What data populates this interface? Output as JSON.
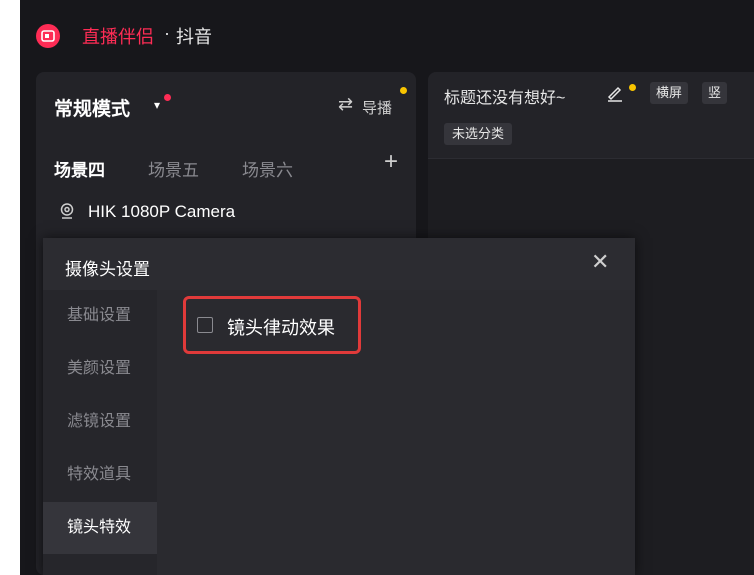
{
  "app": {
    "name": "直播伴侣",
    "separator": "·",
    "subtitle": "抖音",
    "accent_color": "#fe2c55"
  },
  "left_panel": {
    "mode_label": "常规模式",
    "mode_caret": "▾",
    "guide_icon": "⇄",
    "guide_label": "导播",
    "scene_tabs": [
      {
        "label": "场景四",
        "active": true
      },
      {
        "label": "场景五",
        "active": false
      },
      {
        "label": "场景六",
        "active": false
      }
    ],
    "add_scene_icon": "+",
    "camera_source": "HIK 1080P Camera"
  },
  "right_panel": {
    "stream_title": "标题还没有想好~",
    "orientation_landscape": "横屏",
    "orientation_portrait": "竖",
    "category": "未选分类"
  },
  "dialog": {
    "title": "摄像头设置",
    "close_icon": "✕",
    "nav_items": [
      {
        "label": "基础设置",
        "active": false
      },
      {
        "label": "美颜设置",
        "active": false
      },
      {
        "label": "滤镜设置",
        "active": false
      },
      {
        "label": "特效道具",
        "active": false
      },
      {
        "label": "镜头特效",
        "active": true
      }
    ],
    "option_label": "镜头律动效果",
    "option_checked": false,
    "highlight_color": "#e03a3a"
  }
}
